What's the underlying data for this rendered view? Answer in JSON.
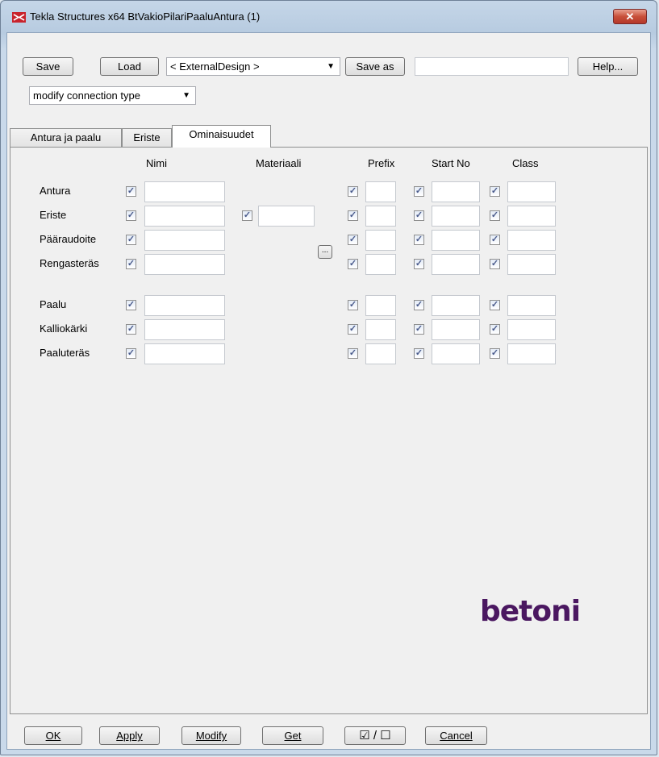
{
  "window": {
    "title": "Tekla Structures x64  BtVakioPilariPaaluAntura (1)",
    "close_label": "✕"
  },
  "toolbar": {
    "save_label": "Save",
    "load_label": "Load",
    "preset_value": "< ExternalDesign >",
    "save_as_label": "Save as",
    "save_as_value": "",
    "help_label": "Help..."
  },
  "mode_select": {
    "value": "modify connection type"
  },
  "tabs": [
    {
      "label": "Antura ja paalu"
    },
    {
      "label": "Eriste"
    },
    {
      "label": "Ominaisuudet"
    }
  ],
  "columns": {
    "nimi": "Nimi",
    "materiaali": "Materiaali",
    "prefix": "Prefix",
    "start_no": "Start No",
    "class": "Class"
  },
  "rows": [
    {
      "label": "Antura"
    },
    {
      "label": "Eriste"
    },
    {
      "label": "Pääraudoite"
    },
    {
      "label": "Rengasteräs"
    },
    {
      "label": "Paalu"
    },
    {
      "label": "Kalliokärki"
    },
    {
      "label": "Paaluteräs"
    }
  ],
  "materiaali_browse_label": "...",
  "logo_text": "betoni",
  "footer": {
    "ok_label": "OK",
    "apply_label": "Apply",
    "modify_label": "Modify",
    "get_label": "Get",
    "toggle_label": "☑ / ☐",
    "cancel_label": "Cancel"
  },
  "colors": {
    "logo": "#4a1760",
    "checkmark": "#4a5b8c"
  }
}
